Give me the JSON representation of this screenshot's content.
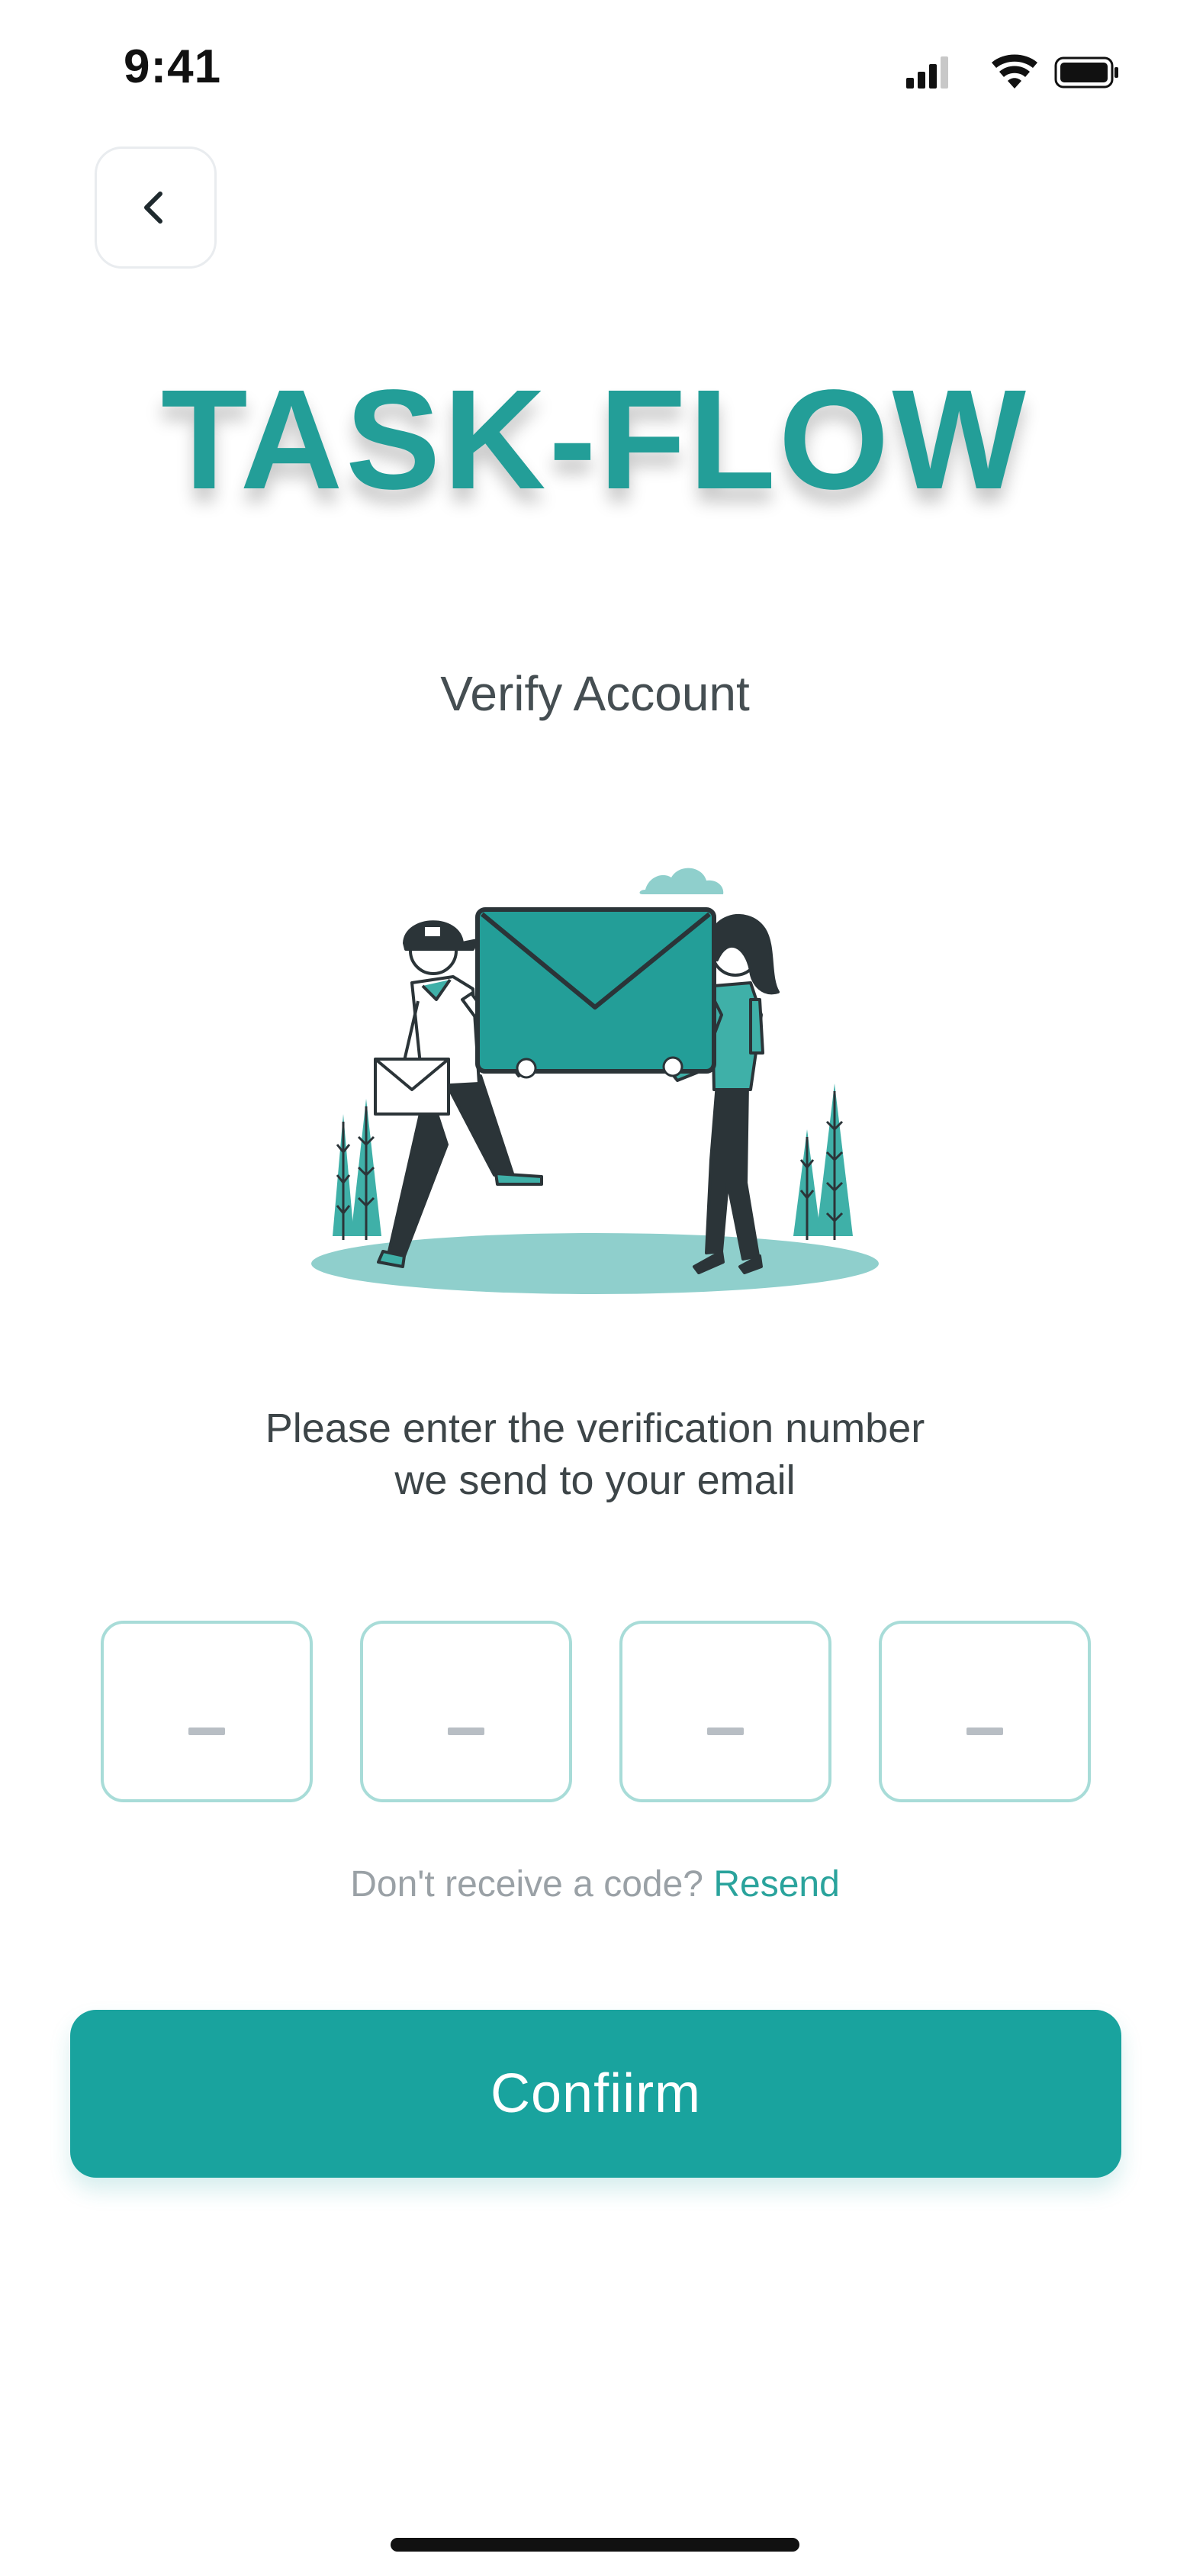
{
  "status_bar": {
    "time": "9:41",
    "icons": [
      "cellular-signal-icon",
      "wifi-icon",
      "battery-icon"
    ]
  },
  "navigation": {
    "back_icon": "chevron-left-icon"
  },
  "brand": {
    "logo_text": "TASK-FLOW",
    "color": "#239e98"
  },
  "screen": {
    "title": "Verify Account"
  },
  "illustration": {
    "icon": "mail-delivery-illustration"
  },
  "instruction": {
    "line1": "Please enter the verification number",
    "line2": "we send to your email"
  },
  "otp": {
    "digits": [
      {
        "value": "",
        "placeholder": "–"
      },
      {
        "value": "",
        "placeholder": "–"
      },
      {
        "value": "",
        "placeholder": "–"
      },
      {
        "value": "",
        "placeholder": "–"
      }
    ]
  },
  "resend": {
    "prompt": "Don't receive a code?",
    "link_label": "Resend"
  },
  "confirm_button": {
    "label": "Confiirm"
  },
  "colors": {
    "primary": "#19a39e",
    "accent": "#2aa39c",
    "otp_border": "#a8dcd8",
    "dark": "#2b3438"
  }
}
